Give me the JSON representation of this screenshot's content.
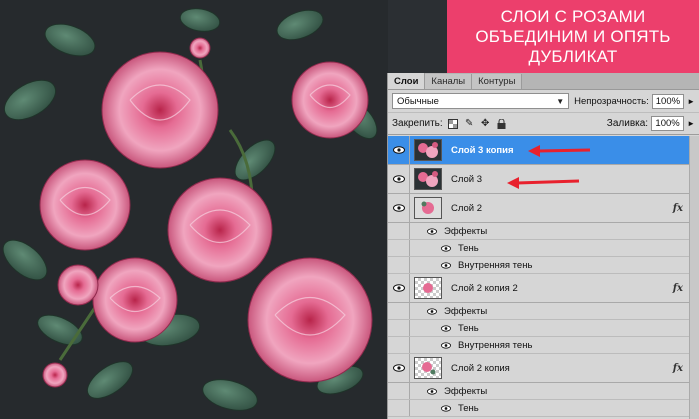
{
  "banner": {
    "line1": "СЛОИ С РОЗАМИ",
    "line2": "ОБЪЕДИНИМ И ОПЯТЬ",
    "line3": "ДУБЛИКАТ"
  },
  "panel": {
    "tabs": [
      {
        "label": "Слои",
        "active": true
      },
      {
        "label": "Каналы",
        "active": false
      },
      {
        "label": "Контуры",
        "active": false
      }
    ],
    "blend_mode": "Обычные",
    "opacity_label": "Непрозрачность:",
    "opacity_value": "100%",
    "lock_label": "Закрепить:",
    "fill_label": "Заливка:",
    "fill_value": "100%",
    "layers": [
      {
        "name": "Слой 3 копия",
        "selected": true
      },
      {
        "name": "Слой 3",
        "selected": false
      },
      {
        "name": "Слой 2",
        "selected": false,
        "fx": "fx",
        "effects_label": "Эффекты",
        "effects": [
          "Тень",
          "Внутренняя тень"
        ]
      },
      {
        "name": "Слой 2 копия 2",
        "selected": false,
        "fx": "fx",
        "effects_label": "Эффекты",
        "effects": [
          "Тень",
          "Внутренняя тень"
        ]
      },
      {
        "name": "Слой 2 копия",
        "selected": false,
        "fx": "fx",
        "effects_label": "Эффекты",
        "effects": [
          "Тень"
        ]
      }
    ]
  },
  "colors": {
    "banner_bg": "#ec3f6c",
    "selected_layer": "#3a8ee8",
    "annotation_arrow": "#e8212d"
  }
}
